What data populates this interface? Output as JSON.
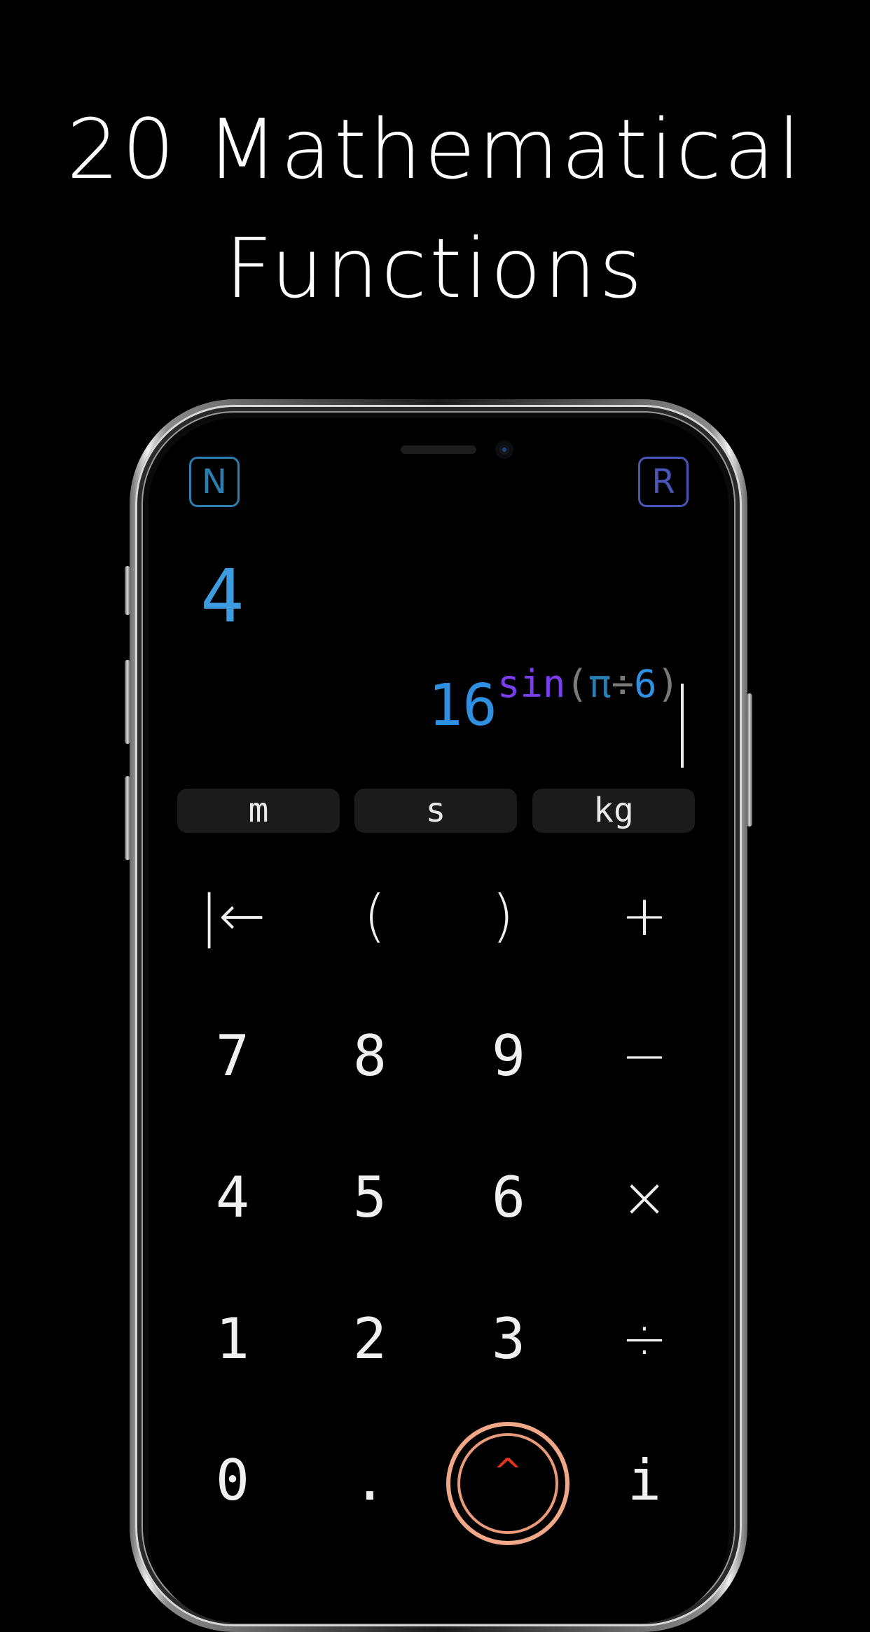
{
  "headline": {
    "line1": "20 Mathematical",
    "line2": "Functions"
  },
  "mode": {
    "left": "N",
    "right": "R"
  },
  "display": {
    "result": "4",
    "expression": {
      "base": "16",
      "fn": "sin",
      "open": "(",
      "pi": "π",
      "op": "÷",
      "num": "6",
      "close": ")"
    }
  },
  "units": [
    "m",
    "s",
    "kg"
  ],
  "keypad": {
    "row1": [
      "|←",
      "(",
      ")",
      "+"
    ],
    "row2": [
      "7",
      "8",
      "9",
      "−"
    ],
    "row3": [
      "4",
      "5",
      "6",
      "×"
    ],
    "row4": [
      "1",
      "2",
      "3",
      "÷"
    ],
    "row5": [
      "0",
      ".",
      "^",
      "i"
    ]
  },
  "colors": {
    "accent_blue": "#3d9be0",
    "accent_purple": "#7a3df0",
    "ring": "#f0a888",
    "chevron": "#e2341f"
  }
}
